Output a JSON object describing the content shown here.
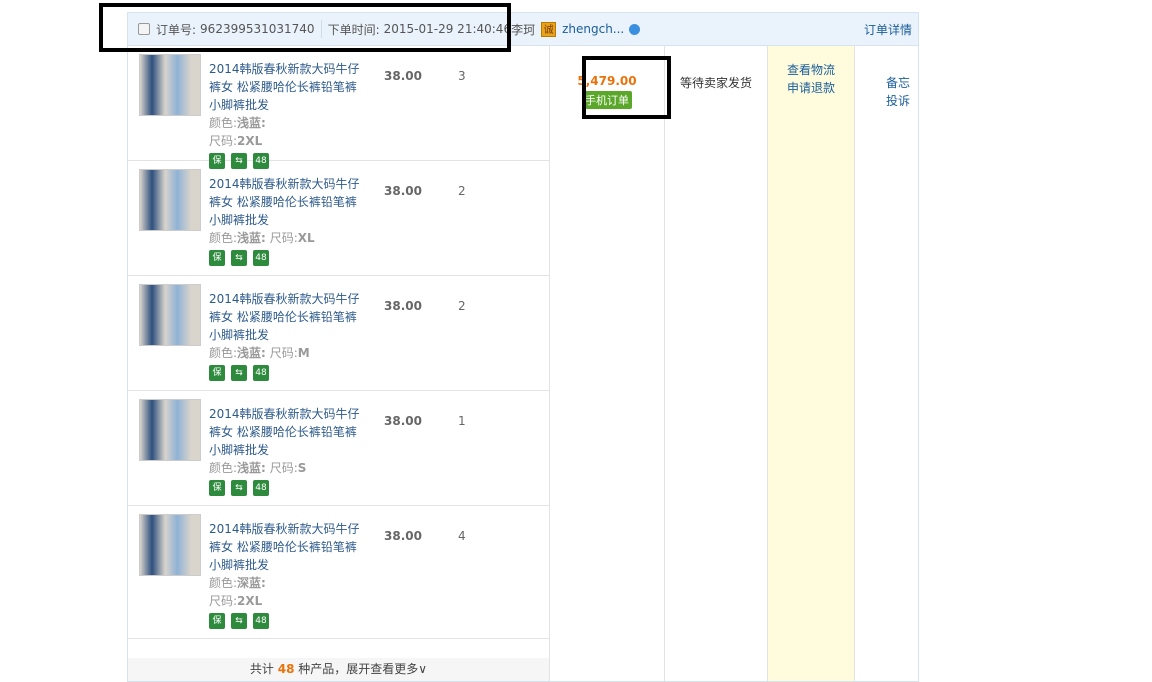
{
  "header": {
    "order_no_label": "订单号:",
    "order_no": "962399531031740",
    "time_label": "下单时间:",
    "time": "2015-01-29 21:40:46",
    "buyer": "李珂",
    "cheng_badge": "诚",
    "seller": "zhengch...",
    "detail_link": "订单详情"
  },
  "products": [
    {
      "title": "2014韩版春秋新款大码牛仔裤女 松紧腰哈伦长裤铅笔裤小脚裤批发",
      "color_label": "颜色:",
      "color": "浅蓝:",
      "size_label": "尺码:",
      "size": "2XL",
      "price": "38.00",
      "qty": "3",
      "size_newline": true
    },
    {
      "title": "2014韩版春秋新款大码牛仔裤女 松紧腰哈伦长裤铅笔裤小脚裤批发",
      "color_label": "颜色:",
      "color": "浅蓝:",
      "size_label": "尺码:",
      "size": "XL",
      "price": "38.00",
      "qty": "2",
      "size_newline": false
    },
    {
      "title": "2014韩版春秋新款大码牛仔裤女 松紧腰哈伦长裤铅笔裤小脚裤批发",
      "color_label": "颜色:",
      "color": "浅蓝:",
      "size_label": "尺码:",
      "size": "M",
      "price": "38.00",
      "qty": "2",
      "size_newline": false
    },
    {
      "title": "2014韩版春秋新款大码牛仔裤女 松紧腰哈伦长裤铅笔裤小脚裤批发",
      "color_label": "颜色:",
      "color": "浅蓝:",
      "size_label": "尺码:",
      "size": "S",
      "price": "38.00",
      "qty": "1",
      "size_newline": false
    },
    {
      "title": "2014韩版春秋新款大码牛仔裤女 松紧腰哈伦长裤铅笔裤小脚裤批发",
      "color_label": "颜色:",
      "color": "深蓝:",
      "size_label": "尺码:",
      "size": "2XL",
      "price": "38.00",
      "qty": "4",
      "size_newline": true
    }
  ],
  "badges": [
    "保",
    "⇆",
    "48"
  ],
  "footer": {
    "prefix": "共计",
    "count": "48",
    "suffix": "种产品，展开查看更多∨"
  },
  "order": {
    "total": "5,479.00",
    "mobile_tag": "手机订单",
    "status": "等待卖家发货",
    "actions": [
      "查看物流",
      "申请退款"
    ],
    "extra": [
      "备忘",
      "投诉"
    ]
  }
}
